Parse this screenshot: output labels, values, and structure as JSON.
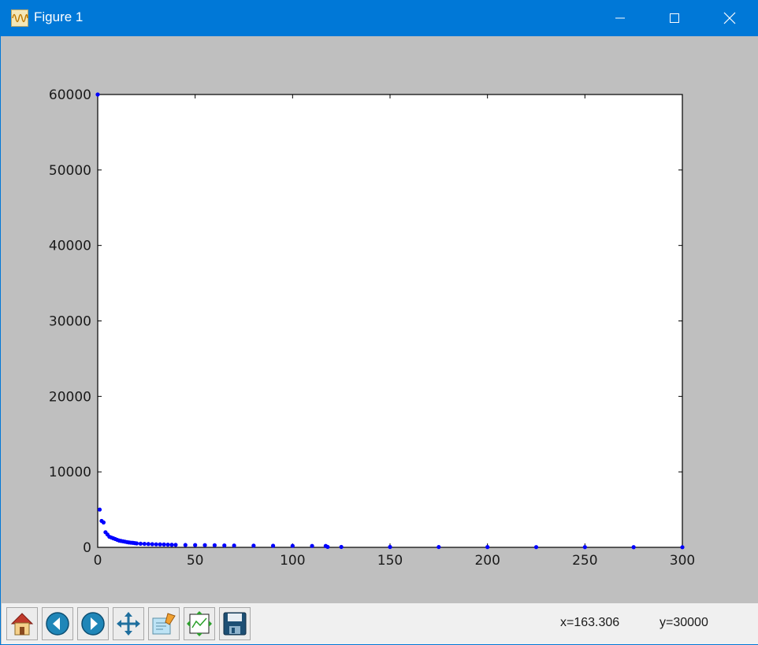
{
  "window": {
    "title": "Figure 1",
    "accent_color": "#0078d7",
    "controls": [
      {
        "name": "minimize",
        "icon": "minimize-icon"
      },
      {
        "name": "maximize",
        "icon": "maximize-icon"
      },
      {
        "name": "close",
        "icon": "close-icon"
      }
    ]
  },
  "toolbar": {
    "buttons": [
      {
        "name": "home",
        "icon": "home-icon"
      },
      {
        "name": "back",
        "icon": "back-arrow-icon"
      },
      {
        "name": "forward",
        "icon": "forward-arrow-icon"
      },
      {
        "name": "pan",
        "icon": "pan-icon"
      },
      {
        "name": "zoom",
        "icon": "zoom-icon"
      },
      {
        "name": "subplots",
        "icon": "subplots-icon"
      },
      {
        "name": "save",
        "icon": "save-icon"
      }
    ],
    "coord_x": "x=163.306",
    "coord_y": "y=30000"
  },
  "chart_data": {
    "type": "scatter",
    "title": "",
    "xlabel": "",
    "ylabel": "",
    "xlim": [
      0,
      300
    ],
    "ylim": [
      0,
      60000
    ],
    "xticks": [
      0,
      50,
      100,
      150,
      200,
      250,
      300
    ],
    "yticks": [
      0,
      10000,
      20000,
      30000,
      40000,
      50000,
      60000
    ],
    "grid": false,
    "marker_color": "#0000ff",
    "series": [
      {
        "x": [
          0,
          1,
          2,
          3,
          4,
          5,
          6,
          7,
          8,
          9,
          10,
          11,
          12,
          13,
          14,
          15,
          16,
          17,
          18,
          19,
          20,
          22,
          24,
          26,
          28,
          30,
          32,
          34,
          36,
          38,
          40,
          45,
          50,
          55,
          60,
          65,
          70,
          80,
          90,
          100,
          110,
          117,
          118,
          125,
          150,
          175,
          200,
          225,
          250,
          275,
          300
        ],
        "y": [
          60000,
          5000,
          3500,
          3300,
          2000,
          1700,
          1400,
          1300,
          1200,
          1100,
          1000,
          900,
          850,
          800,
          750,
          700,
          650,
          620,
          600,
          560,
          520,
          480,
          460,
          440,
          420,
          400,
          390,
          380,
          360,
          340,
          330,
          310,
          300,
          290,
          280,
          250,
          240,
          220,
          210,
          200,
          190,
          180,
          60,
          55,
          50,
          45,
          40,
          35,
          30,
          25,
          20
        ]
      }
    ]
  }
}
